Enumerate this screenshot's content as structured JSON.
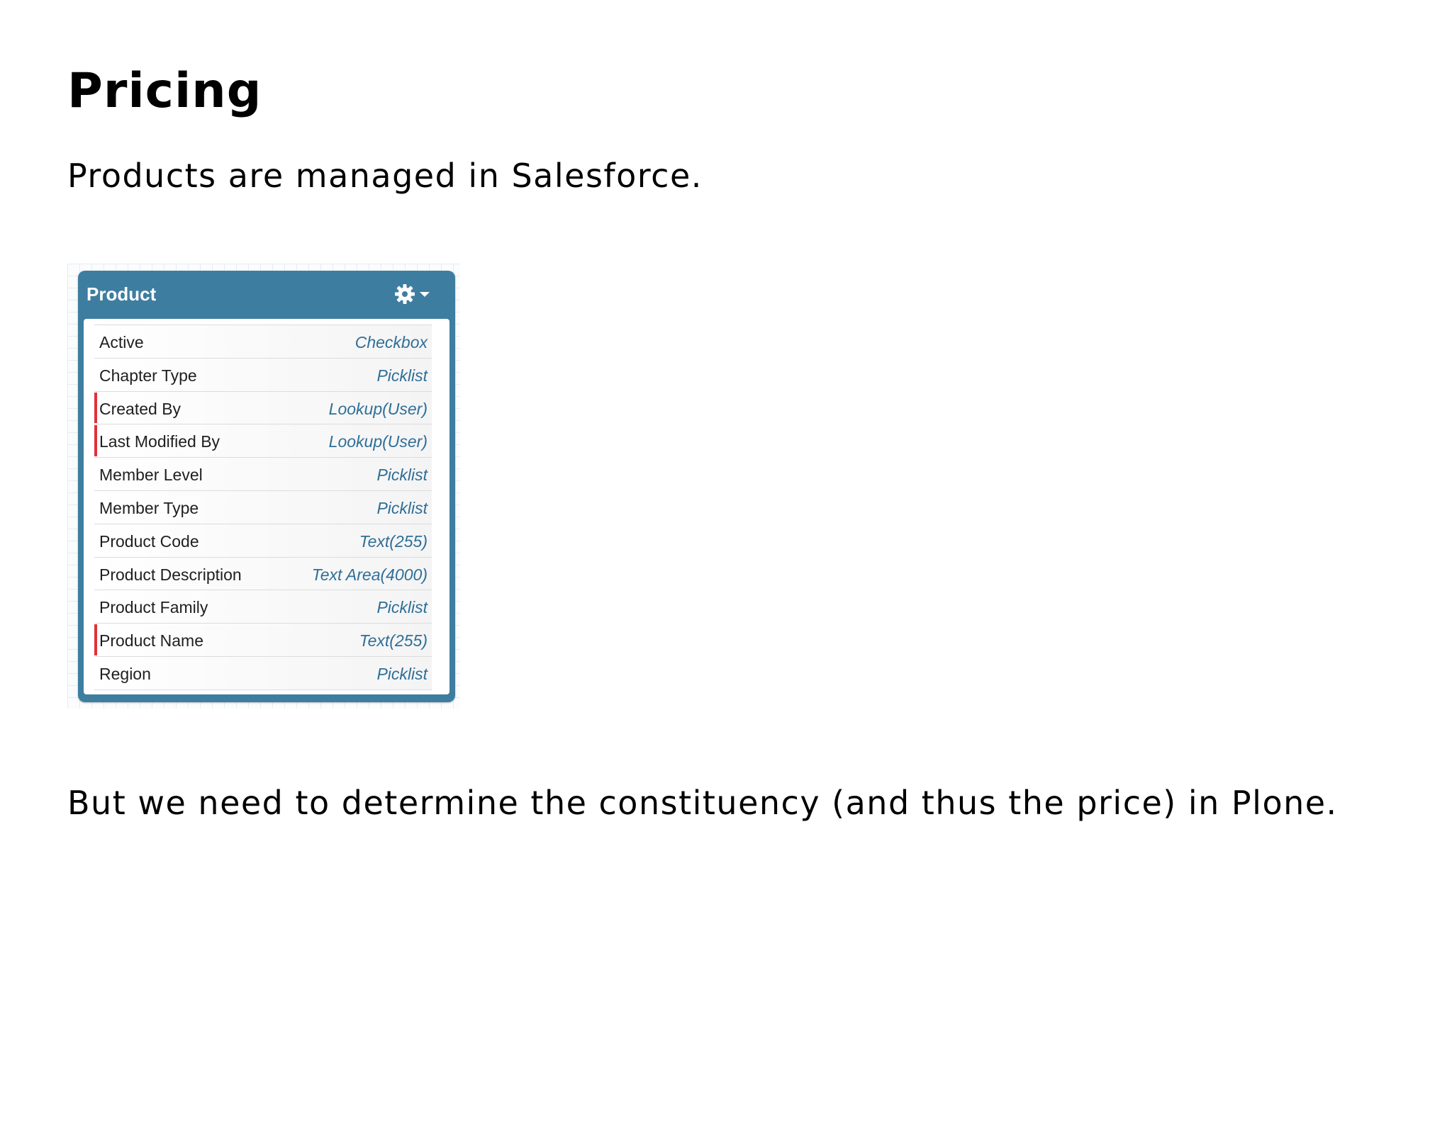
{
  "page": {
    "title": "Pricing",
    "intro": "Products are managed in Salesforce.",
    "conclusion": "But we need to determine the constituency (and thus the price) in Plone."
  },
  "schema": {
    "object_name": "Product",
    "menu_icon": "gear-icon",
    "menu_caret_icon": "chevron-down-icon",
    "colors": {
      "header": "#3d7ea0",
      "type_text": "#2f6f98",
      "required_marker": "#e0313a"
    },
    "fields": [
      {
        "name": "Active",
        "type": "Checkbox",
        "required": false
      },
      {
        "name": "Chapter Type",
        "type": "Picklist",
        "required": false
      },
      {
        "name": "Created By",
        "type": "Lookup(User)",
        "required": true
      },
      {
        "name": "Last Modified By",
        "type": "Lookup(User)",
        "required": true
      },
      {
        "name": "Member Level",
        "type": "Picklist",
        "required": false
      },
      {
        "name": "Member Type",
        "type": "Picklist",
        "required": false
      },
      {
        "name": "Product Code",
        "type": "Text(255)",
        "required": false
      },
      {
        "name": "Product Description",
        "type": "Text Area(4000)",
        "required": false
      },
      {
        "name": "Product Family",
        "type": "Picklist",
        "required": false
      },
      {
        "name": "Product Name",
        "type": "Text(255)",
        "required": true
      },
      {
        "name": "Region",
        "type": "Picklist",
        "required": false
      }
    ]
  }
}
